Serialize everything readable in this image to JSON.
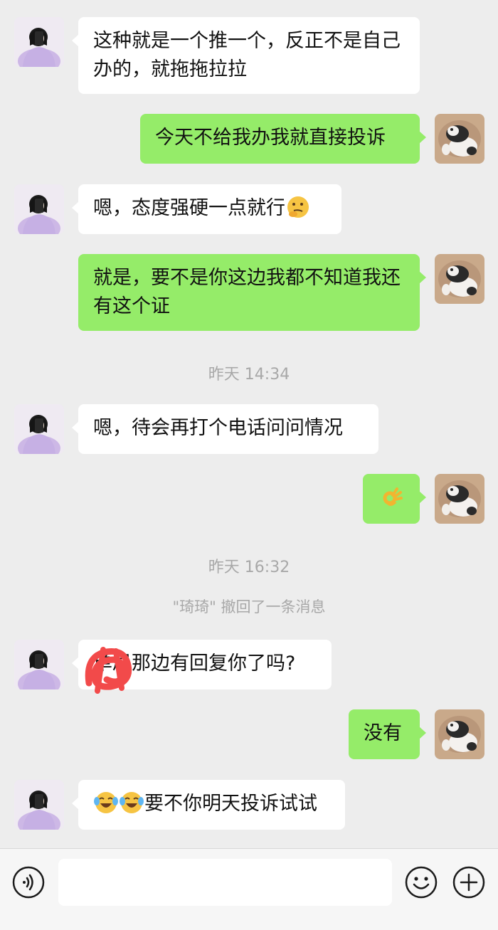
{
  "contacts": {
    "other_name": "琦琦"
  },
  "messages": [
    {
      "id": "m1",
      "side": "in",
      "text": "这种就是一个推一个，反正不是自己办的，就拖拖拉拉"
    },
    {
      "id": "m2",
      "side": "out",
      "text": "今天不给我办我就直接投诉"
    },
    {
      "id": "m3",
      "side": "in",
      "text": "嗯，态度强硬一点就行",
      "emoji_after": "thinking-face-emoji"
    },
    {
      "id": "m4",
      "side": "out",
      "text": "就是，要不是你这边我都不知道我还有这个证"
    },
    {
      "id": "m5",
      "side": "in",
      "text": "嗯，待会再打个电话问问情况"
    },
    {
      "id": "m6",
      "side": "out",
      "emoji": "ok-hand-emoji"
    },
    {
      "id": "m7",
      "side": "in",
      "text": "单局那边有回复你了吗?"
    },
    {
      "id": "m8",
      "side": "out",
      "text": "没有"
    },
    {
      "id": "m9",
      "side": "in",
      "emoji_before": [
        "crying-laughing-emoji",
        "crying-laughing-emoji"
      ],
      "text": "要不你明天投诉试试"
    }
  ],
  "timestamps": {
    "t1": "昨天 14:34",
    "t2": "昨天 16:32"
  },
  "system": {
    "recall_notice": "\"琦琦\" 撤回了一条消息"
  },
  "input_bar": {
    "value": "",
    "voice_icon": "voice-icon",
    "emoji_icon": "emoji-icon",
    "add_icon": "plus-icon"
  },
  "colors": {
    "background": "#ededed",
    "incoming_bubble": "#ffffff",
    "outgoing_bubble": "#95ec69",
    "timestamp_text": "#a8a8a8"
  }
}
